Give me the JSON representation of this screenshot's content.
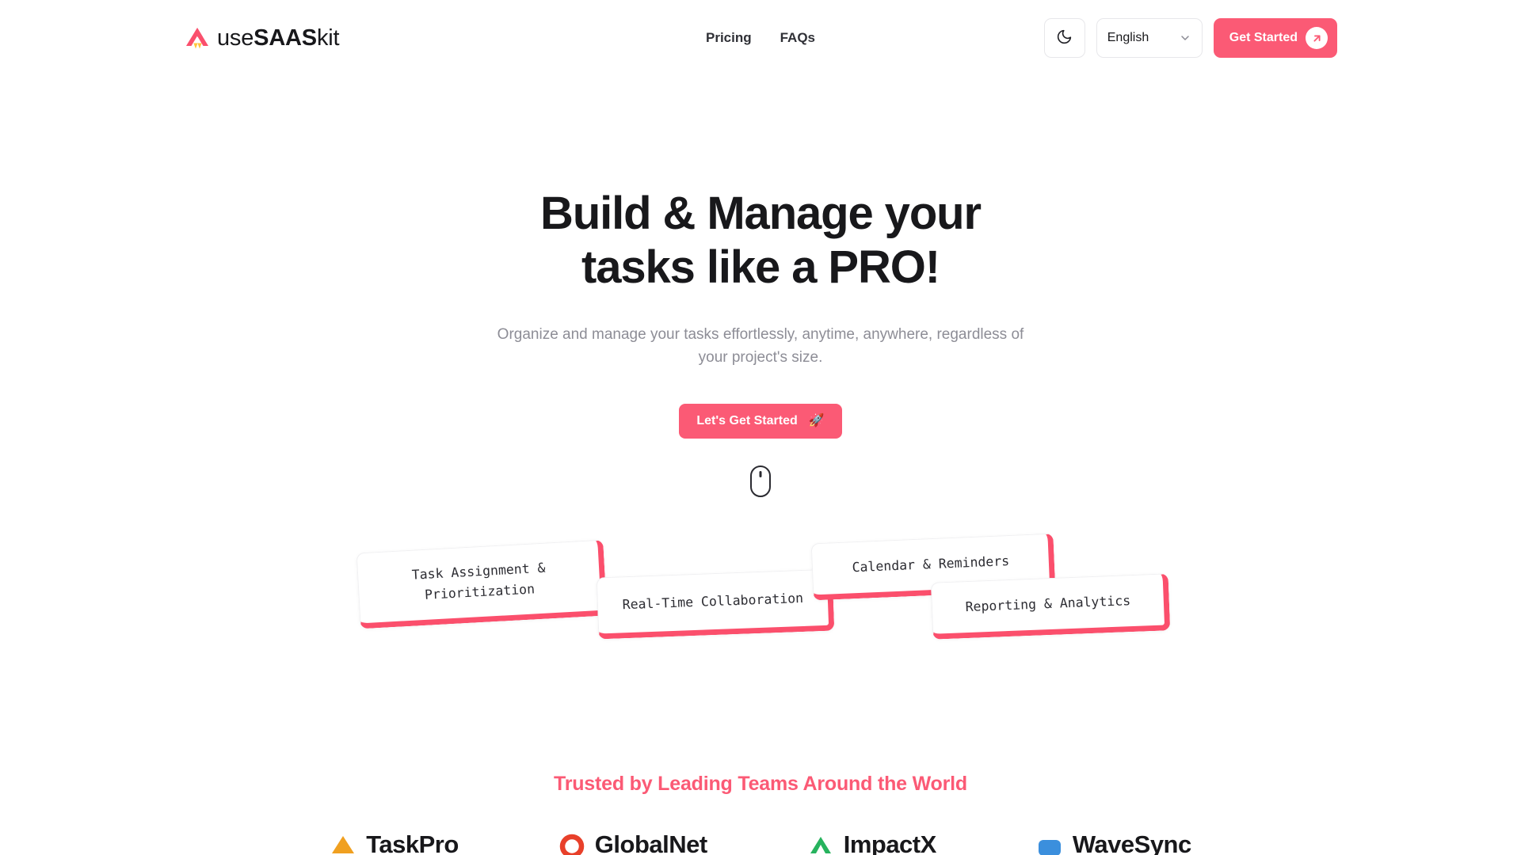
{
  "brand": {
    "name_light": "use",
    "name_bold": "SAAS",
    "name_tail": "kit",
    "logo_icon": "usesaaskit-logo-icon"
  },
  "header": {
    "nav": [
      {
        "label": "Pricing"
      },
      {
        "label": "FAQs"
      }
    ],
    "theme_toggle_icon": "moon-icon",
    "language": {
      "selected": "English",
      "chevron_icon": "chevron-down-icon"
    },
    "cta": {
      "label": "Get Started",
      "icon": "arrow-up-right-icon"
    }
  },
  "hero": {
    "title_line1": "Build & Manage your",
    "title_line2": "tasks like a PRO!",
    "subtitle": "Organize and manage your tasks effortlessly, anytime, anywhere, regardless of your project's size.",
    "cta_label": "Let's Get Started",
    "cta_icon": "🚀",
    "scroll_indicator_icon": "mouse-scroll-icon"
  },
  "feature_cards": [
    {
      "label": "Task Assignment & Prioritization"
    },
    {
      "label": "Real-Time Collaboration"
    },
    {
      "label": "Calendar & Reminders"
    },
    {
      "label": "Reporting & Analytics"
    }
  ],
  "trusted": {
    "title": "Trusted by Leading Teams Around the World",
    "logos": [
      {
        "name": "TaskPro",
        "icon": "orange-triangle-icon",
        "color": "#f0a020"
      },
      {
        "name": "GlobalNet",
        "icon": "red-circle-icon",
        "color": "#e8402a"
      },
      {
        "name": "ImpactX",
        "icon": "green-chevron-icon",
        "color": "#27b35e"
      },
      {
        "name": "WaveSync",
        "icon": "blue-rounded-square-icon",
        "color": "#3b8fdd"
      }
    ]
  },
  "colors": {
    "accent": "#fb5a75",
    "accent_border": "#fb4f6c",
    "text": "#18181b",
    "muted": "#8d8d96"
  }
}
